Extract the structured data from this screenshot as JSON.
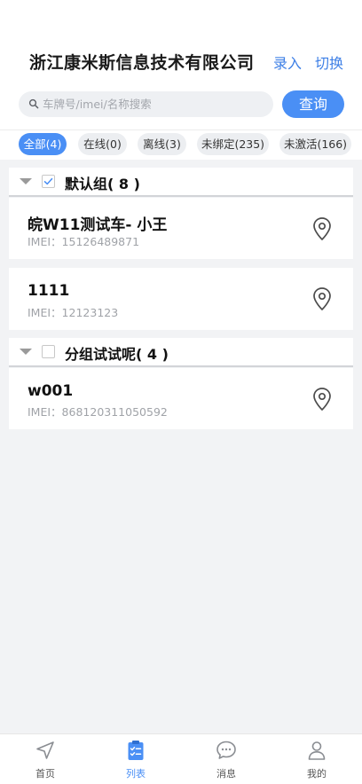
{
  "header": {
    "company_name": "浙江康米斯信息技术有限公司",
    "entry_label": "录入",
    "switch_label": "切换"
  },
  "search": {
    "placeholder": "车牌号/imei/名称搜索",
    "value": "",
    "button_label": "查询"
  },
  "filters": [
    {
      "label": "全部(4)",
      "active": true
    },
    {
      "label": "在线(0)",
      "active": false
    },
    {
      "label": "离线(3)",
      "active": false
    },
    {
      "label": "未绑定(235)",
      "active": false
    },
    {
      "label": "未激活(166)",
      "active": false
    }
  ],
  "groups": [
    {
      "name": "默认组( 8 )",
      "checked": true,
      "devices": [
        {
          "name": "皖W11测试车- 小王",
          "imei": "IMEI：15126489871"
        },
        {
          "name": "1111",
          "imei": "IMEI：12123123"
        }
      ]
    },
    {
      "name": "分组试试呢( 4 )",
      "checked": false,
      "devices": [
        {
          "name": "w001",
          "imei": "IMEI：868120311050592"
        }
      ]
    }
  ],
  "tabbar": [
    {
      "label": "首页",
      "icon": "navigation-arrow-icon",
      "active": false
    },
    {
      "label": "列表",
      "icon": "clipboard-list-icon",
      "active": true
    },
    {
      "label": "消息",
      "icon": "chat-bubble-icon",
      "active": false
    },
    {
      "label": "我的",
      "icon": "user-icon",
      "active": false
    }
  ],
  "colors": {
    "accent": "#4a8ff5",
    "link": "#3d7fe6",
    "background": "#f2f3f5"
  }
}
